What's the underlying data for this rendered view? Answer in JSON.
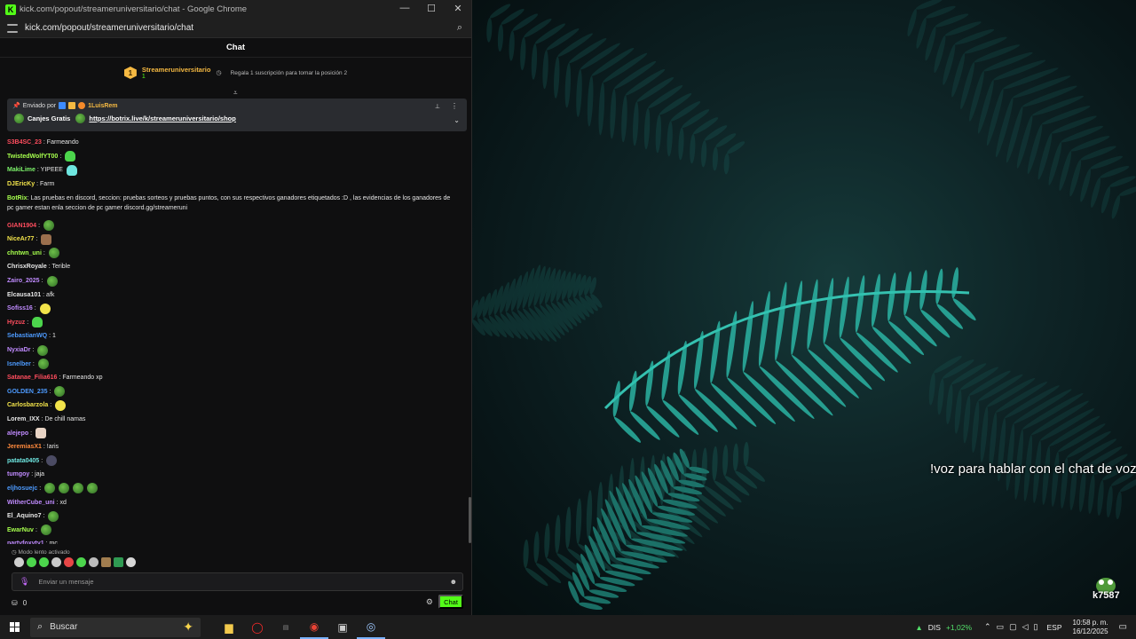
{
  "window": {
    "title": "kick.com/popout/streameruniversitario/chat - Google Chrome",
    "url": "kick.com/popout/streameruniversitario/chat",
    "min": "—",
    "max": "☐",
    "close": "✕"
  },
  "chat": {
    "header": "Chat",
    "leader": {
      "rank": "1",
      "name": "Streameruniversitario",
      "count": "1",
      "tip": "Regala 1 suscripción para tomar la posición 2"
    },
    "pinned": {
      "sent_by": "Enviado por",
      "author": "1LuisRem",
      "label": "Canjes Gratis",
      "link": "https://botrix.live/k/streameruniversitario/shop"
    },
    "messages": [
      {
        "user": "S3B4SC_23",
        "color": "#ff4d5e",
        "text": ": Farmeando",
        "emotes": []
      },
      {
        "user": "TwistedWolfYT00",
        "color": "#a6ff4d",
        "text": ":",
        "emotes": [
          "ghost"
        ]
      },
      {
        "user": "MakiLime",
        "color": "#7cf26a",
        "text": ": YIPEEE",
        "emotes": [
          "cyan"
        ]
      },
      {
        "user": "DJEricKy",
        "color": "#f2e34a",
        "text": ": Farm",
        "emotes": []
      },
      {
        "user": "BotRix",
        "color": "#a6ff4d",
        "text": ": Las pruebas en discord, seccion: pruebas sorteos y pruebas puntos, con sus respectivos ganadores etiquetados :D , las evidencias de los ganadores de pc gamer estan enla seccion de pc gamer discord.gg/streameruni",
        "emotes": [],
        "tall": true
      },
      {
        "user": "GIAN1904",
        "color": "#ff4d5e",
        "text": ":",
        "emotes": [
          "frog"
        ]
      },
      {
        "user": "NiceAr77",
        "color": "#f2e34a",
        "text": ":",
        "emotes": [
          "brown"
        ]
      },
      {
        "user": "chntwn_uni",
        "color": "#a6ff4d",
        "text": ":",
        "emotes": [
          "frog"
        ]
      },
      {
        "user": "ChrisxRoyale",
        "color": "#e6e6e6",
        "text": ": Terible",
        "emotes": []
      },
      {
        "user": "Zairo_2025",
        "color": "#c08bff",
        "text": ":",
        "emotes": [
          "frog"
        ]
      },
      {
        "user": "Elcausa101",
        "color": "#e6e6e6",
        "text": ": afk",
        "emotes": []
      },
      {
        "user": "Sofiss16",
        "color": "#c08bff",
        "text": ":",
        "emotes": [
          "yellow"
        ]
      },
      {
        "user": "Hyzuz",
        "color": "#ff4d5e",
        "text": ":",
        "emotes": [
          "ghost"
        ]
      },
      {
        "user": "SebastianWQ",
        "color": "#4d9bff",
        "text": ": 1",
        "emotes": []
      },
      {
        "user": "NyxiaDr",
        "color": "#c08bff",
        "text": ":",
        "emotes": [
          "frog"
        ]
      },
      {
        "user": "Isnelber",
        "color": "#4d9bff",
        "text": ":",
        "emotes": [
          "frog"
        ]
      },
      {
        "user": "Satanae_Filia616",
        "color": "#ff4d5e",
        "text": ": Farmeando xp",
        "emotes": []
      },
      {
        "user": "GOLDEN_235",
        "color": "#4d9bff",
        "text": ":",
        "emotes": [
          "frog"
        ]
      },
      {
        "user": "Carlosbarzola",
        "color": "#f2e34a",
        "text": ":",
        "emotes": [
          "yellow"
        ]
      },
      {
        "user": "Lorem_IXX",
        "color": "#e6e6e6",
        "text": ": De chill namas",
        "emotes": []
      },
      {
        "user": "alejepo",
        "color": "#c08bff",
        "text": ":",
        "emotes": [
          "hand"
        ]
      },
      {
        "user": "JeremiasX1",
        "color": "#ff8a3d",
        "text": ": !aris",
        "emotes": []
      },
      {
        "user": "patata0405",
        "color": "#6ee6e0",
        "text": ":",
        "emotes": [
          "dark"
        ]
      },
      {
        "user": "tumgoy",
        "color": "#c08bff",
        "text": ": jaja",
        "emotes": []
      },
      {
        "user": "eljhosuejc",
        "color": "#4d9bff",
        "text": ":",
        "emotes": [
          "frog",
          "frog",
          "frog",
          "frog"
        ]
      },
      {
        "user": "WitherCube_uni",
        "color": "#c08bff",
        "text": ": xd",
        "emotes": []
      },
      {
        "user": "El_Aquino7",
        "color": "#e6e6e6",
        "text": ":",
        "emotes": [
          "frog"
        ]
      },
      {
        "user": "EwarNuv",
        "color": "#a6ff4d",
        "text": ":",
        "emotes": [
          "frog"
        ]
      },
      {
        "user": "partyfoxyty1",
        "color": "#c08bff",
        "text": ": mc",
        "emotes": []
      }
    ],
    "slow_mode": "Modo lento activado",
    "input_placeholder": "Enviar un mensaje",
    "points": "0",
    "send_label": "Chat"
  },
  "desktop": {
    "overlay_text": "!voz para hablar con el chat de voz",
    "corner_label": "k7587"
  },
  "taskbar": {
    "search_placeholder": "Buscar",
    "stock_symbol": "DIS",
    "stock_change": "+1,02%",
    "lang": "ESP",
    "time": "10:58 p. m.",
    "date": "16/12/2025"
  },
  "colors": {
    "kick_green": "#53fc18",
    "gold": "#f5b942"
  }
}
